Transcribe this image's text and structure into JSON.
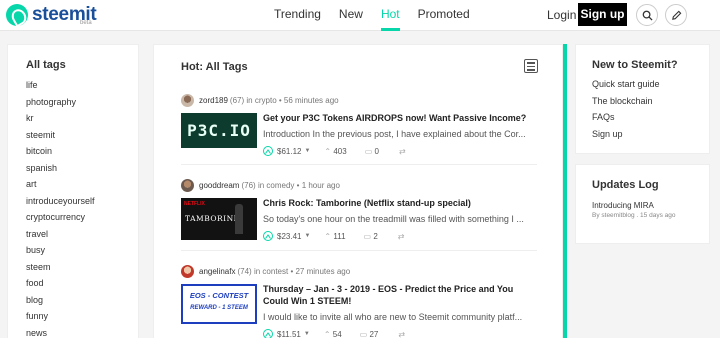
{
  "header": {
    "logo_text": "steemit",
    "logo_beta": "beta",
    "nav": [
      "Trending",
      "New",
      "Hot",
      "Promoted"
    ],
    "active_nav": "Hot",
    "login": "Login",
    "signup": "Sign up"
  },
  "sidebar": {
    "title": "All tags",
    "tags": [
      "life",
      "photography",
      "kr",
      "steemit",
      "bitcoin",
      "spanish",
      "art",
      "introduceyourself",
      "cryptocurrency",
      "travel",
      "busy",
      "steem",
      "food",
      "blog",
      "funny",
      "news"
    ]
  },
  "main": {
    "title": "Hot: All Tags",
    "posts": [
      {
        "author": "zord189",
        "reputation": "(67)",
        "in_text": "in",
        "category": "crypto",
        "time": "56 minutes ago",
        "thumb_text": "P3C.IO",
        "title": "Get your P3C Tokens AIRDROPS now! Want Passive Income?",
        "excerpt": "Introduction In the previous post, I have explained about the Cor...",
        "payout": "$61.12",
        "votes": "403",
        "comments": "0"
      },
      {
        "author": "gooddream",
        "reputation": "(76)",
        "in_text": "in",
        "category": "comedy",
        "time": "1 hour ago",
        "thumb_brand": "NETFLIX",
        "thumb_text": "TAMBORINE",
        "title": "Chris Rock: Tamborine (Netflix stand-up special)",
        "excerpt": "So today's one hour on the treadmill was filled with something I ...",
        "payout": "$23.41",
        "votes": "111",
        "comments": "2"
      },
      {
        "author": "angelinafx",
        "reputation": "(74)",
        "in_text": "in",
        "category": "contest",
        "time": "27 minutes ago",
        "thumb_text": "EOS - CONTEST",
        "thumb_sub": "REWARD - 1 STEEM",
        "title": "Thursday – Jan - 3 - 2019 - EOS - Predict the Price and You Could Win 1 STEEM!",
        "excerpt": "I would like to invite all who are new to Steemit community platf...",
        "payout": "$11.51",
        "votes": "54",
        "comments": "27"
      }
    ]
  },
  "new_panel": {
    "title": "New to Steemit?",
    "links": [
      "Quick start guide",
      "The blockchain",
      "FAQs",
      "Sign up"
    ]
  },
  "updates": {
    "title": "Updates Log",
    "item": "Introducing MIRA",
    "meta": "By steemitblog . 15 days ago"
  },
  "colors": {
    "accent": "#06d6a9",
    "brand": "#1a5099"
  }
}
